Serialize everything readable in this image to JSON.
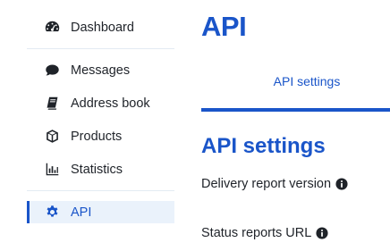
{
  "sidebar": {
    "items": [
      {
        "label": "Dashboard",
        "icon": "dashboard-gauge-icon"
      },
      {
        "label": "Messages",
        "icon": "speech-bubble-icon"
      },
      {
        "label": "Address book",
        "icon": "book-icon"
      },
      {
        "label": "Products",
        "icon": "cube-icon"
      },
      {
        "label": "Statistics",
        "icon": "bar-chart-icon"
      },
      {
        "label": "API",
        "icon": "gear-icon",
        "active": true
      }
    ]
  },
  "main": {
    "title": "API",
    "tabs": [
      {
        "label": "API settings",
        "active": true
      }
    ],
    "section_title": "API settings",
    "fields": [
      {
        "label": "Delivery report version",
        "icon": "info-icon"
      },
      {
        "label": "Status reports URL",
        "icon": "info-icon"
      }
    ]
  },
  "colors": {
    "accent": "#1a55c9",
    "text": "#1f2329",
    "active_bg": "#eaf2fb",
    "divider": "#e3ebf3"
  }
}
